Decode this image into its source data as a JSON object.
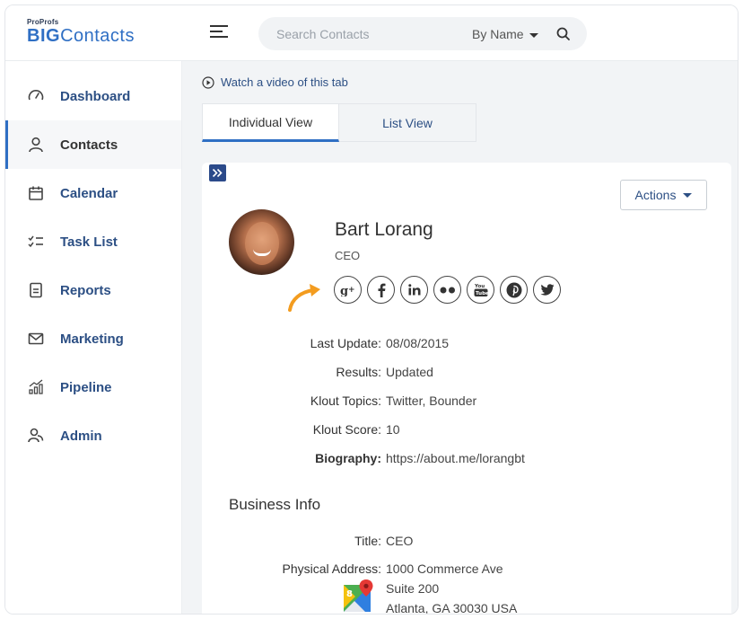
{
  "brand": {
    "top": "ProProfs",
    "big": "BIG",
    "contacts": "Contacts"
  },
  "search": {
    "placeholder": "Search Contacts",
    "by_label": "By Name"
  },
  "sidebar": {
    "items": [
      {
        "label": "Dashboard",
        "icon": "gauge-icon"
      },
      {
        "label": "Contacts",
        "icon": "user-icon",
        "active": true
      },
      {
        "label": "Calendar",
        "icon": "calendar-icon"
      },
      {
        "label": "Task List",
        "icon": "checklist-icon"
      },
      {
        "label": "Reports",
        "icon": "document-icon"
      },
      {
        "label": "Marketing",
        "icon": "envelope-icon"
      },
      {
        "label": "Pipeline",
        "icon": "bar-chart-icon"
      },
      {
        "label": "Admin",
        "icon": "users-icon"
      }
    ]
  },
  "main": {
    "watch_video": "Watch a video of this tab",
    "tabs": [
      {
        "label": "Individual View",
        "active": true
      },
      {
        "label": "List View",
        "active": false
      }
    ]
  },
  "contact": {
    "name": "Bart Lorang",
    "role": "CEO",
    "actions_label": "Actions",
    "socials": [
      "google-plus-icon",
      "facebook-icon",
      "linkedin-icon",
      "flickr-icon",
      "youtube-icon",
      "pinterest-icon",
      "twitter-icon"
    ],
    "fields": [
      {
        "label": "Last Update:",
        "value": "08/08/2015"
      },
      {
        "label": "Results:",
        "value": "Updated"
      },
      {
        "label": "Klout Topics:",
        "value": "Twitter, Bounder"
      },
      {
        "label": "Klout Score:",
        "value": "10"
      },
      {
        "label": "Biography:",
        "value": "https://about.me/lorangbt"
      }
    ]
  },
  "business": {
    "title": "Business Info",
    "title_label": "Title:",
    "title_value": "CEO",
    "address_label": "Physical Address:",
    "address_line1": "1000 Commerce Ave",
    "address_line2": "Suite 200",
    "address_line3": "Atlanta, GA 30030 USA"
  },
  "colors": {
    "accent": "#2f6fc4",
    "nav_text": "#2c4f84",
    "arrow": "#f39c1f",
    "background": "#f2f4f6"
  }
}
